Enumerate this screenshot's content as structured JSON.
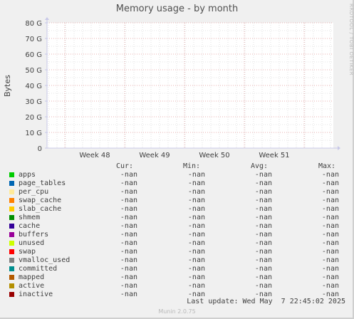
{
  "chart_data": {
    "type": "area",
    "title": "Memory usage - by month",
    "ylabel": "Bytes",
    "xlabel": "",
    "ylim": [
      0,
      80
    ],
    "yunit": "G",
    "yticks": [
      "0",
      "10 G",
      "20 G",
      "30 G",
      "40 G",
      "50 G",
      "60 G",
      "70 G",
      "80 G"
    ],
    "xticks": [
      "Week 48",
      "Week 49",
      "Week 50",
      "Week 51"
    ],
    "grid": true,
    "series": [
      {
        "name": "apps",
        "color": "#00cc00",
        "cur": "-nan",
        "min": "-nan",
        "avg": "-nan",
        "max": "-nan"
      },
      {
        "name": "page_tables",
        "color": "#0066b3",
        "cur": "-nan",
        "min": "-nan",
        "avg": "-nan",
        "max": "-nan"
      },
      {
        "name": "per_cpu",
        "color": "#ffea9a",
        "cur": "-nan",
        "min": "-nan",
        "avg": "-nan",
        "max": "-nan"
      },
      {
        "name": "swap_cache",
        "color": "#ff8000",
        "cur": "-nan",
        "min": "-nan",
        "avg": "-nan",
        "max": "-nan"
      },
      {
        "name": "slab_cache",
        "color": "#ffcc00",
        "cur": "-nan",
        "min": "-nan",
        "avg": "-nan",
        "max": "-nan"
      },
      {
        "name": "shmem",
        "color": "#008f00",
        "cur": "-nan",
        "min": "-nan",
        "avg": "-nan",
        "max": "-nan"
      },
      {
        "name": "cache",
        "color": "#330099",
        "cur": "-nan",
        "min": "-nan",
        "avg": "-nan",
        "max": "-nan"
      },
      {
        "name": "buffers",
        "color": "#990099",
        "cur": "-nan",
        "min": "-nan",
        "avg": "-nan",
        "max": "-nan"
      },
      {
        "name": "unused",
        "color": "#ccff00",
        "cur": "-nan",
        "min": "-nan",
        "avg": "-nan",
        "max": "-nan"
      },
      {
        "name": "swap",
        "color": "#ff0000",
        "cur": "-nan",
        "min": "-nan",
        "avg": "-nan",
        "max": "-nan"
      },
      {
        "name": "vmalloc_used",
        "color": "#808080",
        "cur": "-nan",
        "min": "-nan",
        "avg": "-nan",
        "max": "-nan"
      },
      {
        "name": "committed",
        "color": "#008f8f",
        "cur": "-nan",
        "min": "-nan",
        "avg": "-nan",
        "max": "-nan"
      },
      {
        "name": "mapped",
        "color": "#b35a00",
        "cur": "-nan",
        "min": "-nan",
        "avg": "-nan",
        "max": "-nan"
      },
      {
        "name": "active",
        "color": "#b38f00",
        "cur": "-nan",
        "min": "-nan",
        "avg": "-nan",
        "max": "-nan"
      },
      {
        "name": "inactive",
        "color": "#990000",
        "cur": "-nan",
        "min": "-nan",
        "avg": "-nan",
        "max": "-nan"
      }
    ]
  },
  "legend_headers": {
    "cur": "Cur:",
    "min": "Min:",
    "avg": "Avg:",
    "max": "Max:"
  },
  "side_text": "RRDTOOL / TOBI OETIKER",
  "last_update": "Last update: Wed May  7 22:45:02 2025",
  "footer": "Munin 2.0.75"
}
